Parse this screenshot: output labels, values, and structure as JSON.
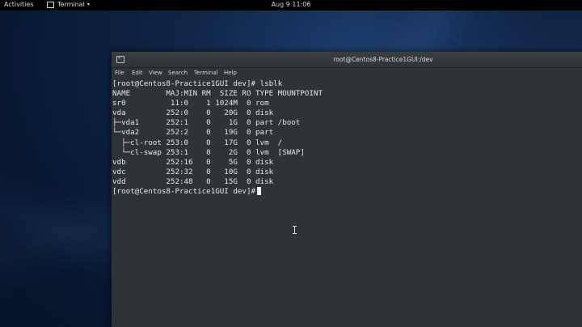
{
  "topbar": {
    "activities_label": "Activities",
    "app_menu_label": "Terminal",
    "clock": "Aug 9  11:06"
  },
  "window": {
    "title": "root@Centos8-Practice1GUI:/dev",
    "menu": [
      "File",
      "Edit",
      "View",
      "Search",
      "Terminal",
      "Help"
    ]
  },
  "terminal": {
    "prompt": "[root@Centos8-Practice1GUI dev]#",
    "command": "lsblk",
    "lines": [
      "NAME        MAJ:MIN RM  SIZE RO TYPE MOUNTPOINT",
      "sr0          11:0    1 1024M  0 rom",
      "vda         252:0    0   20G  0 disk",
      "├─vda1      252:1    0    1G  0 part /boot",
      "└─vda2      252:2    0   19G  0 part",
      "  ├─cl-root 253:0    0   17G  0 lvm  /",
      "  └─cl-swap 253:1    0    2G  0 lvm  [SWAP]",
      "vdb         252:16   0    5G  0 disk",
      "vdc         252:32   0   10G  0 disk",
      "vdd         252:48   0   15G  0 disk"
    ]
  }
}
